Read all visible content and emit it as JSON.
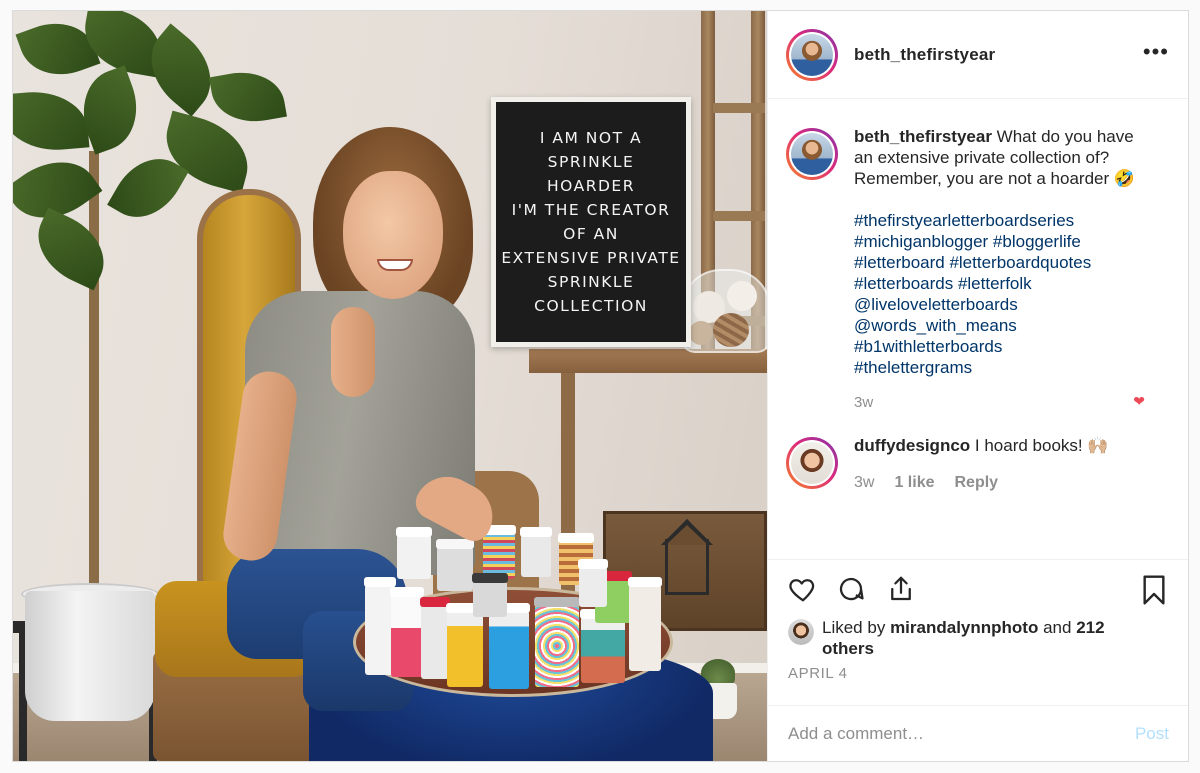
{
  "post": {
    "letterboard_lines": [
      "I AM NOT A",
      "SPRINKLE",
      "HOARDER",
      "I'M THE CREATOR",
      "OF AN",
      "EXTENSIVE PRIVATE",
      "SPRINKLE",
      "COLLECTION"
    ]
  },
  "header": {
    "username": "beth_thefirstyear",
    "more_icon": "•••"
  },
  "caption": {
    "username": "beth_thefirstyear",
    "text": "What do you have an extensive private collection of? Remember, you are not a hoarder 🤣",
    "hashtags": [
      "#thefirstyearletterboardseries",
      "#michiganblogger #bloggerlife",
      "#letterboard #letterboardquotes",
      "#letterboards #letterfolk",
      "@liveloveletterboards",
      "@words_with_means",
      "#b1withletterboards",
      "#thelettergrams"
    ],
    "time": "3w"
  },
  "comment": {
    "username": "duffydesignco",
    "text": "I hoard books! 🙌🏼",
    "time": "3w",
    "likes": "1 like",
    "reply": "Reply",
    "heart_icon": "❤"
  },
  "likes": {
    "prefix": "Liked by",
    "user": "miranda lynnphoto",
    "user_display": "mirandalynnphoto",
    "suffix": "and",
    "others": "212 others"
  },
  "date": "APRIL 4",
  "add_comment": {
    "placeholder": "Add a comment…",
    "post_label": "Post"
  },
  "colors": {
    "link": "#003569",
    "muted": "#8e8e8e",
    "post_disabled": "#b2dffc",
    "heart": "#ed4956"
  }
}
